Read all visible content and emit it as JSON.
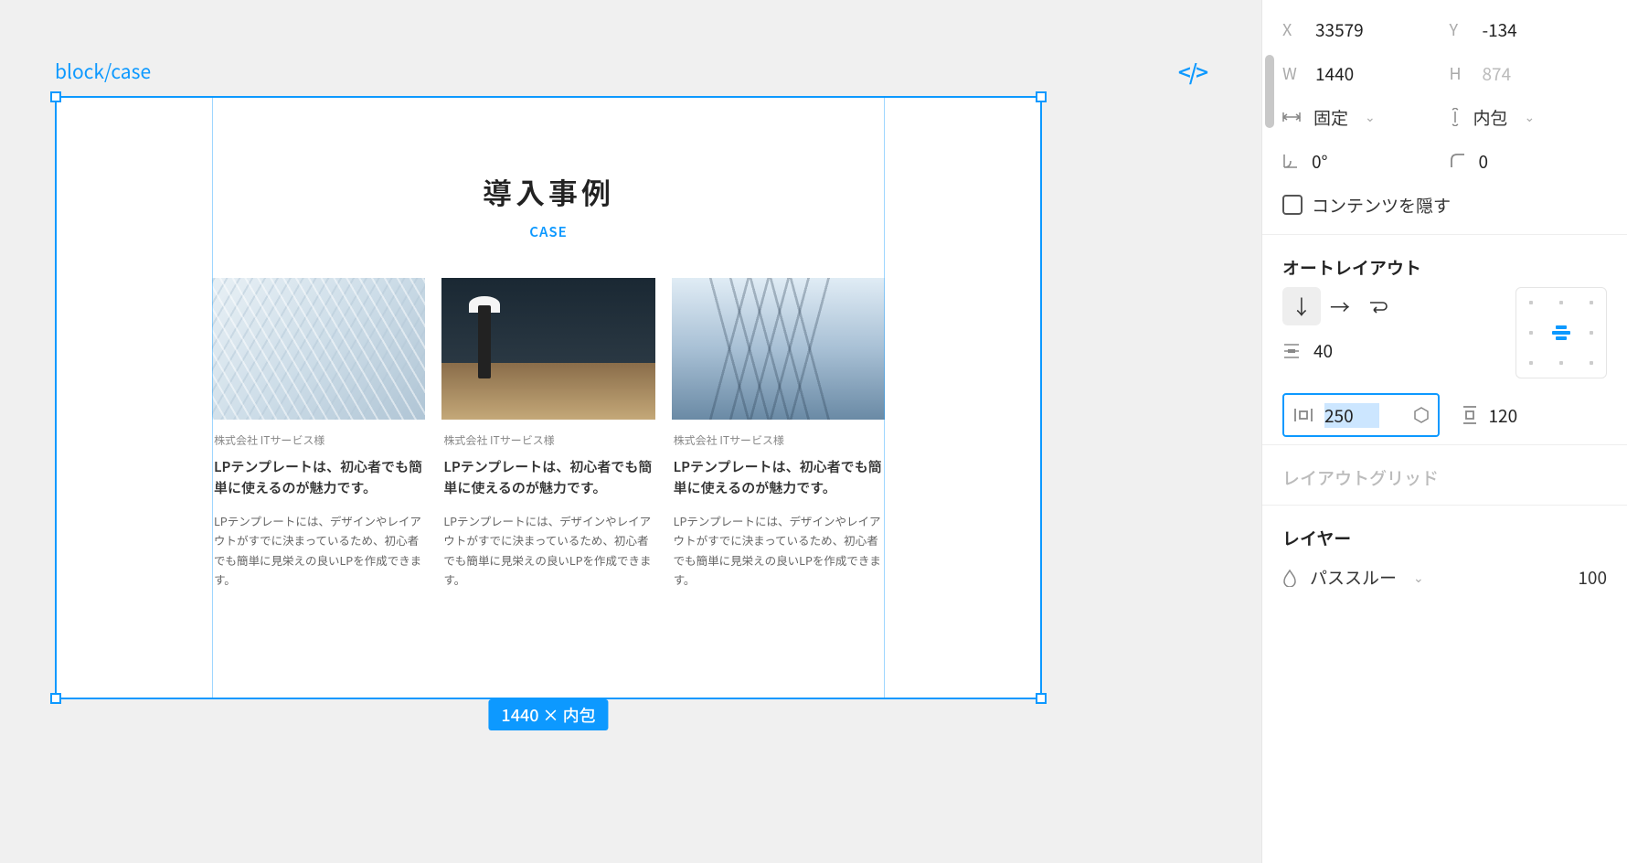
{
  "canvas": {
    "frame_label": "block/case",
    "dim_badge": "1440 × 内包",
    "section_title": "導入事例",
    "section_subtitle": "CASE",
    "cards": [
      {
        "company": "株式会社 ITサービス様",
        "title": "LPテンプレートは、初心者でも簡単に使えるのが魅力です。",
        "desc": "LPテンプレートには、デザインやレイアウトがすでに決まっているため、初心者でも簡単に見栄えの良いLPを作成できます。"
      },
      {
        "company": "株式会社 ITサービス様",
        "title": "LPテンプレートは、初心者でも簡単に使えるのが魅力です。",
        "desc": "LPテンプレートには、デザインやレイアウトがすでに決まっているため、初心者でも簡単に見栄えの良いLPを作成できます。"
      },
      {
        "company": "株式会社 ITサービス様",
        "title": "LPテンプレートは、初心者でも簡単に使えるのが魅力です。",
        "desc": "LPテンプレートには、デザインやレイアウトがすでに決まっているため、初心者でも簡単に見栄えの良いLPを作成できます。"
      }
    ]
  },
  "panel": {
    "position": {
      "x_label": "X",
      "x": "33579",
      "y_label": "Y",
      "y": "-134"
    },
    "size": {
      "w_label": "W",
      "w": "1440",
      "h_label": "H",
      "h": "874"
    },
    "constraints": {
      "horizontal": "固定",
      "vertical": "内包"
    },
    "rotation": "0°",
    "corner_radius": "0",
    "clip_content": "コンテンツを隠す",
    "autolayout_heading": "オートレイアウト",
    "gap": "40",
    "padding_h": "250",
    "padding_v": "120",
    "layout_grid_heading": "レイアウトグリッド",
    "layer_heading": "レイヤー",
    "blend_mode": "パススルー",
    "opacity": "100"
  }
}
